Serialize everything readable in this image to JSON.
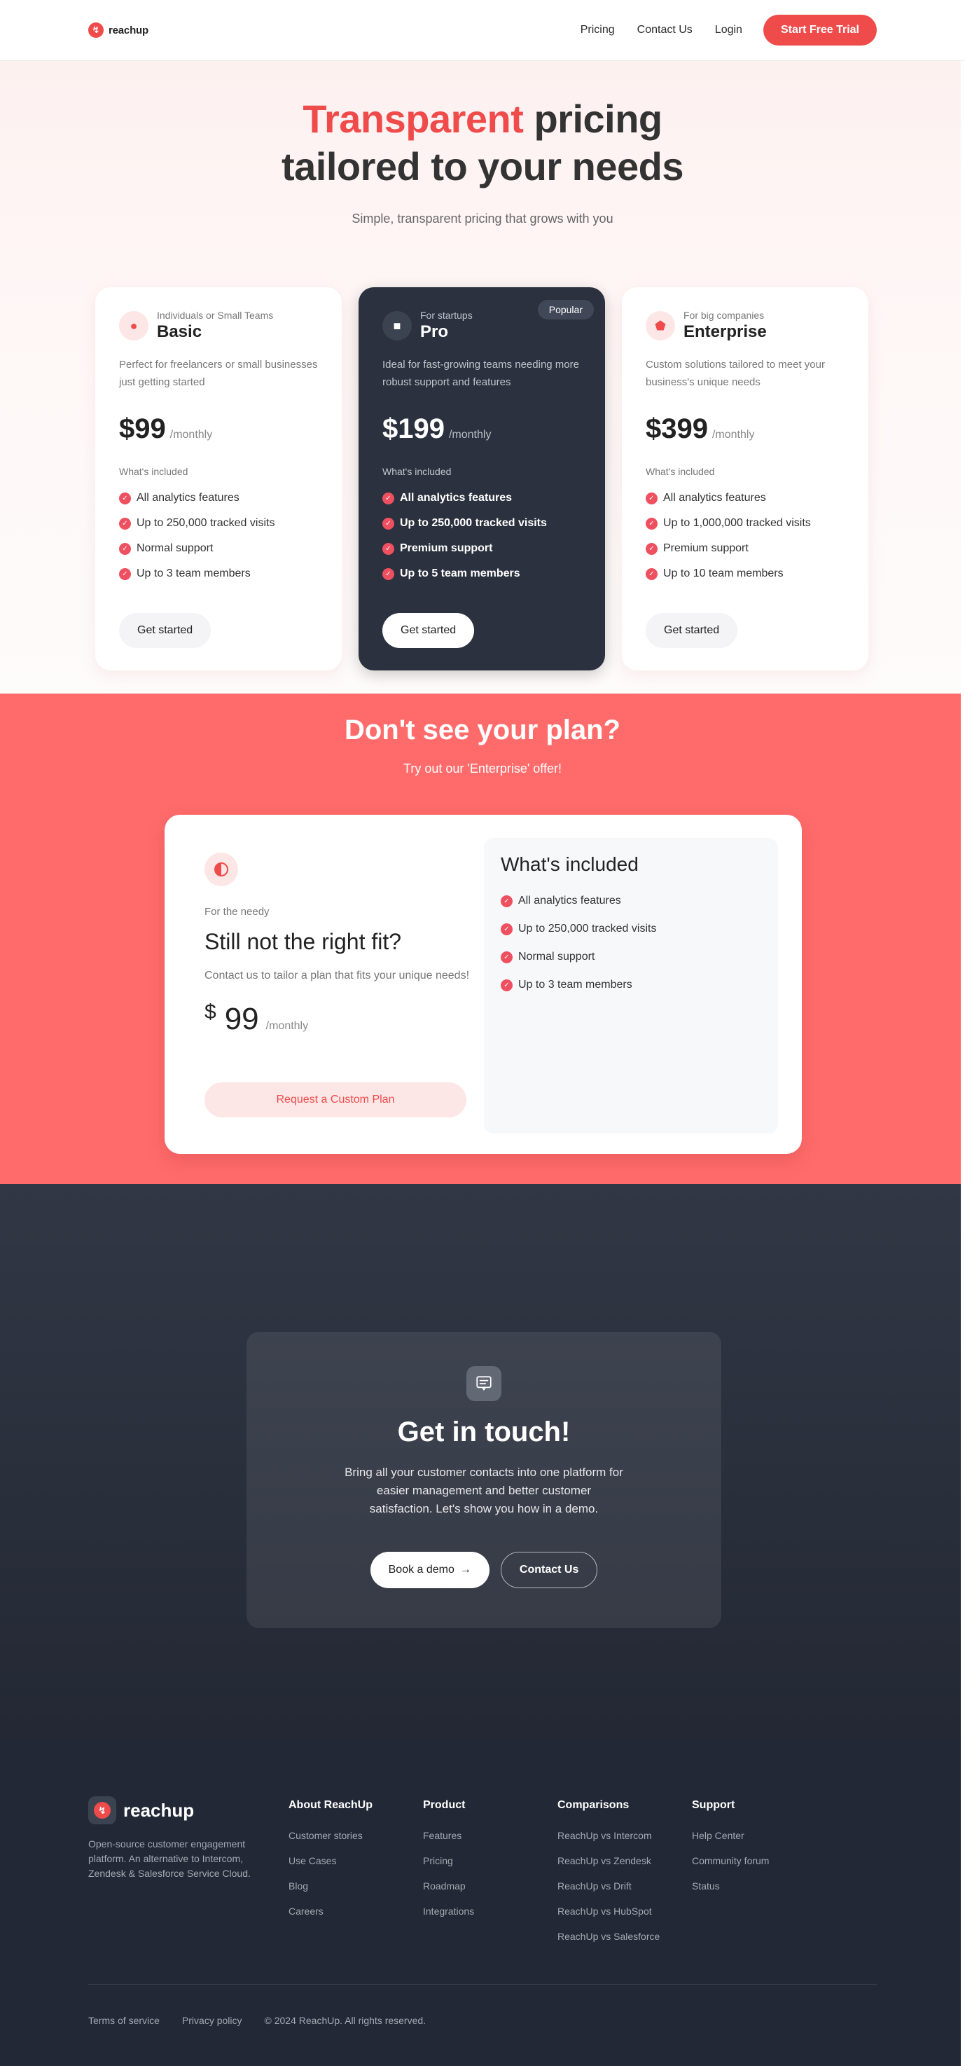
{
  "nav": {
    "logo_text": "reachup",
    "links": [
      "Pricing",
      "Contact Us",
      "Login"
    ],
    "cta": "Start Free Trial"
  },
  "hero": {
    "title_accent": "Transparent",
    "title_rest_1": " pricing",
    "title_line_2": "tailored to your needs",
    "subtitle": "Simple, transparent pricing that grows with you"
  },
  "plans": [
    {
      "kicker": "Individuals or Small Teams",
      "name": "Basic",
      "description": "Perfect for freelancers or small businesses just getting started",
      "price": "$99",
      "per": "/monthly",
      "included_label": "What's included",
      "features": [
        "All analytics features",
        "Up to 250,000 tracked visits",
        "Normal support",
        "Up to 3 team members"
      ],
      "button": "Get started"
    },
    {
      "kicker": "For startups",
      "name": "Pro",
      "badge": "Popular",
      "description": "Ideal for fast-growing teams needing more robust support and features",
      "price": "$199",
      "per": "/monthly",
      "included_label": "What's included",
      "features": [
        "All analytics features",
        "Up to 250,000 tracked visits",
        "Premium support",
        "Up to 5 team members"
      ],
      "button": "Get started"
    },
    {
      "kicker": "For big companies",
      "name": "Enterprise",
      "description": "Custom solutions tailored to meet your business's unique needs",
      "price": "$399",
      "per": "/monthly",
      "included_label": "What's included",
      "features": [
        "All analytics features",
        "Up to 1,000,000 tracked visits",
        "Premium support",
        "Up to 10 team members"
      ],
      "button": "Get started"
    }
  ],
  "custom": {
    "title": "Don't see your plan?",
    "subtitle": "Try out our 'Enterprise' offer!",
    "kicker": "For the needy",
    "card_title": "Still not the right fit?",
    "card_desc": "Contact us to tailor a plan that fits your unique needs!",
    "currency": "$",
    "amount": "99",
    "per": "/monthly",
    "button": "Request a Custom Plan",
    "included_title": "What's included",
    "features": [
      "All analytics features",
      "Up to 250,000 tracked visits",
      "Normal support",
      "Up to 3 team members"
    ]
  },
  "contact": {
    "title": "Get in touch!",
    "description": "Bring all your customer contacts into one platform for easier management and better customer satisfaction. Let's show you how in a demo.",
    "demo_button": "Book a demo",
    "demo_arrow": "→",
    "contact_button": "Contact Us"
  },
  "footer": {
    "logo_text": "reachup",
    "description": "Open-source customer engagement platform. An alternative to Intercom, Zendesk & Salesforce Service Cloud.",
    "columns": [
      {
        "title": "About ReachUp",
        "links": [
          "Customer stories",
          "Use Cases",
          "Blog",
          "Careers"
        ]
      },
      {
        "title": "Product",
        "links": [
          "Features",
          "Pricing",
          "Roadmap",
          "Integrations"
        ]
      },
      {
        "title": "Comparisons",
        "links": [
          "ReachUp vs Intercom",
          "ReachUp vs Zendesk",
          "ReachUp vs Drift",
          "ReachUp vs HubSpot",
          "ReachUp vs Salesforce"
        ]
      },
      {
        "title": "Support",
        "links": [
          "Help Center",
          "Community forum",
          "Status"
        ]
      }
    ],
    "bottom": [
      "Terms of service",
      "Privacy policy",
      "© 2024 ReachUp. All rights reserved."
    ]
  },
  "colors": {
    "accent": "#ef4b4b",
    "coral_section": "#ff6b6b",
    "dark_card": "#2b313e",
    "footer": "#222836"
  },
  "icons": {
    "basic": "dot-icon",
    "pro": "square-icon",
    "enterprise": "pentagon-icon",
    "custom": "half-circle-icon",
    "contact": "message-icon",
    "check": "check-icon"
  }
}
